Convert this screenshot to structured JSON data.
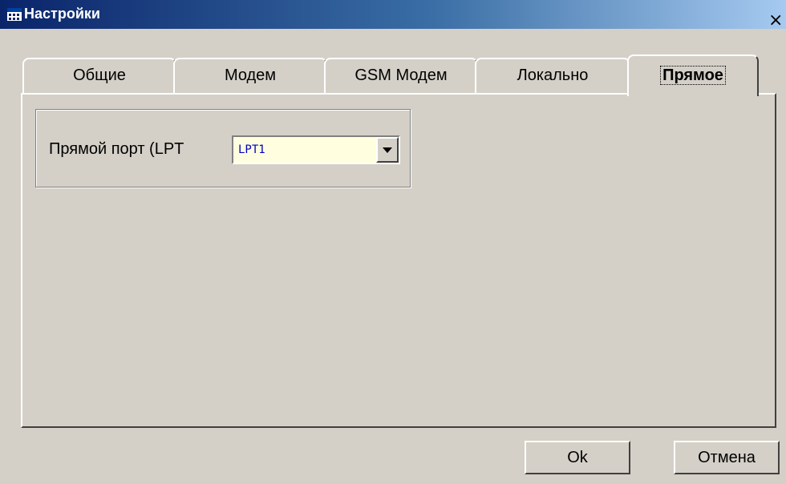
{
  "window": {
    "title": "Настройки",
    "close_glyph": "×"
  },
  "icons": {
    "app": "calculator-icon",
    "close": "close-icon",
    "dropdown": "chevron-down-icon"
  },
  "tabs": [
    {
      "label": "Общие"
    },
    {
      "label": "Модем"
    },
    {
      "label": "GSM Модем"
    },
    {
      "label": "Локально"
    },
    {
      "label": "Прямое",
      "active": true
    }
  ],
  "direct": {
    "port_label": "Прямой порт (LPT",
    "port_value": "LPT1"
  },
  "buttons": {
    "ok": "Ok",
    "cancel": "Отмена"
  },
  "colors": {
    "title_start": "#0a246a",
    "title_end": "#a6caf0",
    "face": "#d4d0c8",
    "combo_bg": "#ffffe0",
    "combo_text": "#0000c0"
  }
}
